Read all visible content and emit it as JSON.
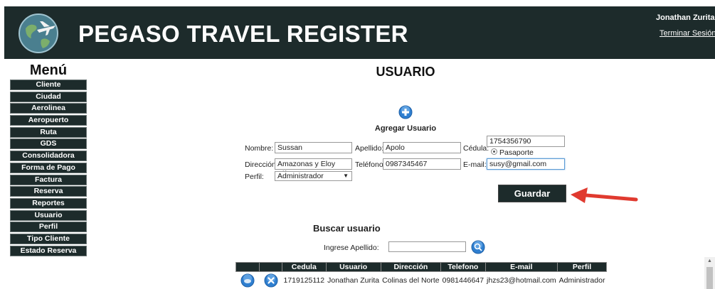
{
  "header": {
    "brand": "PEGASO TRAVEL REGISTER",
    "user_name": "Jonathan Zurita",
    "logout_label": "Terminar Sesión",
    "logo_icon": "globe-airplane-logo"
  },
  "menu": {
    "title": "Menú",
    "items": [
      "Cliente",
      "Ciudad",
      "Aerolinea",
      "Aeropuerto",
      "Ruta",
      "GDS",
      "Consolidadora",
      "Forma de Pago",
      "Factura",
      "Reserva",
      "Reportes",
      "Usuario",
      "Perfil",
      "Tipo Cliente",
      "Estado Reserva"
    ]
  },
  "page": {
    "title": "USUARIO"
  },
  "form": {
    "add_title": "Agregar Usuario",
    "nombre_label": "Nombre:",
    "nombre_value": "Sussan",
    "apellido_label": "Apellido:",
    "apellido_value": "Apolo",
    "cedula_label": "Cédula:",
    "cedula_value": "1754356790",
    "pasaporte_label": "Pasaporte",
    "direccion_label": "Dirección:",
    "direccion_value": "Amazonas y Eloy Alfaro",
    "telefono_label": "Teléfono:",
    "telefono_value": "0987345467",
    "email_label": "E-mail:",
    "email_value": "susy@gmail.com",
    "perfil_label": "Perfil:",
    "perfil_value": "Administrador",
    "save_label": "Guardar"
  },
  "search": {
    "title": "Buscar usuario",
    "apellido_label": "Ingrese Apellido:",
    "apellido_value": ""
  },
  "table": {
    "headers": [
      "Cedula",
      "Usuario",
      "Dirección",
      "Telefono",
      "E-mail",
      "Perfil"
    ],
    "rows": [
      [
        "1719125112",
        "Jonathan Zurita",
        "Colinas del Norte",
        "0981446647",
        "jhzs23@hotmail.com",
        "Administrador"
      ]
    ]
  },
  "colors": {
    "dark": "#1d2b2b",
    "annotation_arrow": "#e03a2f",
    "icon_blue": "#2f7fd0"
  }
}
